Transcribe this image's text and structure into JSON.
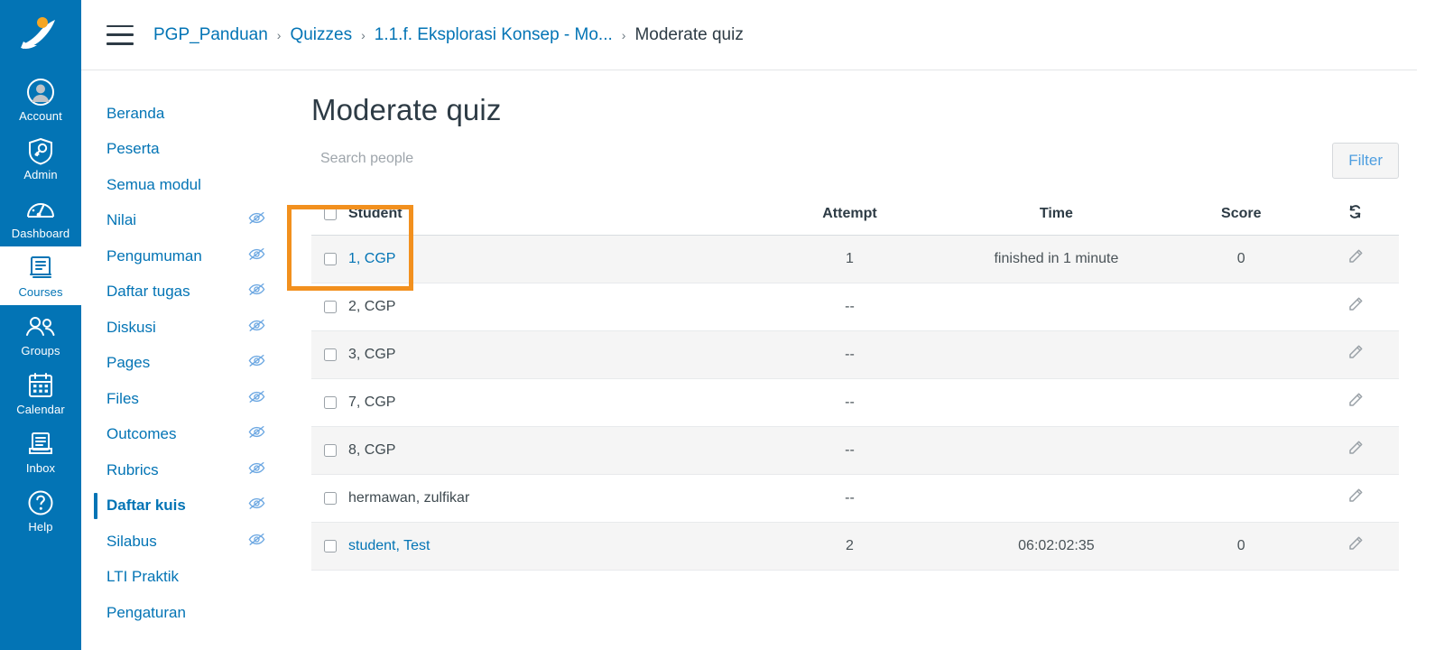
{
  "global_nav": {
    "logo_icon": "canvas-logo-icon",
    "items": [
      {
        "label": "Account",
        "icon": "user-circle-icon",
        "active": false
      },
      {
        "label": "Admin",
        "icon": "shield-key-icon",
        "active": false
      },
      {
        "label": "Dashboard",
        "icon": "gauge-icon",
        "active": false
      },
      {
        "label": "Courses",
        "icon": "book-icon",
        "active": true
      },
      {
        "label": "Groups",
        "icon": "people-icon",
        "active": false
      },
      {
        "label": "Calendar",
        "icon": "calendar-icon",
        "active": false
      },
      {
        "label": "Inbox",
        "icon": "envelope-icon",
        "active": false
      },
      {
        "label": "Help",
        "icon": "question-circle-icon",
        "active": false
      }
    ]
  },
  "breadcrumb": {
    "menu_icon": "hamburger-icon",
    "separator": "›",
    "items": [
      {
        "label": "PGP_Panduan",
        "current": false
      },
      {
        "label": "Quizzes",
        "current": false
      },
      {
        "label": "1.1.f. Eksplorasi Konsep - Mo...",
        "current": false
      },
      {
        "label": "Moderate quiz",
        "current": true
      }
    ]
  },
  "course_nav": {
    "items": [
      {
        "label": "Beranda",
        "hidden_icon": false,
        "active": false
      },
      {
        "label": "Peserta",
        "hidden_icon": false,
        "active": false
      },
      {
        "label": "Semua modul",
        "hidden_icon": false,
        "active": false
      },
      {
        "label": "Nilai",
        "hidden_icon": true,
        "active": false
      },
      {
        "label": "Pengumuman",
        "hidden_icon": true,
        "active": false
      },
      {
        "label": "Daftar tugas",
        "hidden_icon": true,
        "active": false
      },
      {
        "label": "Diskusi",
        "hidden_icon": true,
        "active": false
      },
      {
        "label": "Pages",
        "hidden_icon": true,
        "active": false
      },
      {
        "label": "Files",
        "hidden_icon": true,
        "active": false
      },
      {
        "label": "Outcomes",
        "hidden_icon": true,
        "active": false
      },
      {
        "label": "Rubrics",
        "hidden_icon": true,
        "active": false
      },
      {
        "label": "Daftar kuis",
        "hidden_icon": true,
        "active": true
      },
      {
        "label": "Silabus",
        "hidden_icon": true,
        "active": false
      },
      {
        "label": "LTI Praktik",
        "hidden_icon": false,
        "active": false
      },
      {
        "label": "Pengaturan",
        "hidden_icon": false,
        "active": false
      }
    ]
  },
  "main": {
    "title": "Moderate quiz",
    "search": {
      "placeholder": "Search people",
      "value": ""
    },
    "filter_label": "Filter",
    "refresh_icon": "refresh-icon",
    "edit_icon": "pencil-icon",
    "table": {
      "headers": {
        "student": "Student",
        "attempt": "Attempt",
        "time": "Time",
        "score": "Score"
      },
      "rows": [
        {
          "student": "1, CGP",
          "is_link": true,
          "attempt": "1",
          "time": "finished in 1 minute",
          "score": "0",
          "checked": false
        },
        {
          "student": "2, CGP",
          "is_link": false,
          "attempt": "--",
          "time": "",
          "score": "",
          "checked": false
        },
        {
          "student": "3, CGP",
          "is_link": false,
          "attempt": "--",
          "time": "",
          "score": "",
          "checked": false
        },
        {
          "student": "7, CGP",
          "is_link": false,
          "attempt": "--",
          "time": "",
          "score": "",
          "checked": false
        },
        {
          "student": "8, CGP",
          "is_link": false,
          "attempt": "--",
          "time": "",
          "score": "",
          "checked": false
        },
        {
          "student": "hermawan, zulfikar",
          "is_link": false,
          "attempt": "--",
          "time": "",
          "score": "",
          "checked": false
        },
        {
          "student": "student, Test",
          "is_link": true,
          "attempt": "2",
          "time": "06:02:02:35",
          "score": "0",
          "checked": false
        }
      ]
    }
  },
  "highlight": {
    "color": "#F2901E",
    "target": "student-column-and-first-row"
  },
  "colors": {
    "brand_blue": "#0374B5",
    "nav_blue": "#0374B5",
    "text_dark": "#2D3B45",
    "highlight_orange": "#F2901E",
    "row_stripe": "#F5F5F5"
  }
}
